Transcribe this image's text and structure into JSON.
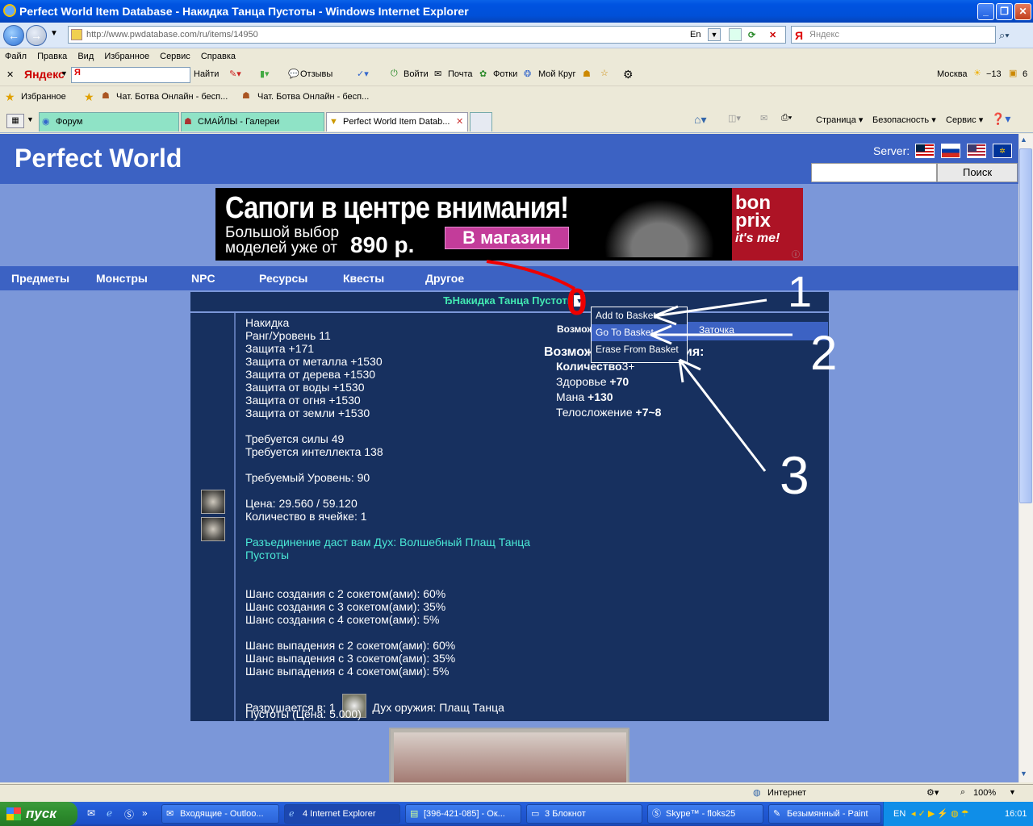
{
  "window": {
    "title": "Perfect World Item Database - Накидка Танца Пустоты - Windows Internet Explorer"
  },
  "address": {
    "url": "http://www.pwdatabase.com/ru/items/14950",
    "lang": "En",
    "search_placeholder": "Яндекс"
  },
  "menu": [
    "Файл",
    "Правка",
    "Вид",
    "Избранное",
    "Сервис",
    "Справка"
  ],
  "yandex_bar": {
    "brand": "Яндекс",
    "find": "Найти",
    "otzyvy": "Отзывы",
    "voiti": "Войти",
    "pochta": "Почта",
    "fotki": "Фотки",
    "moi_krug": "Мой Круг",
    "city": "Москва",
    "temp": "−13",
    "num": "6"
  },
  "favorites": {
    "label": "Избранное",
    "items": [
      "Чат. Ботва Онлайн - бесп...",
      "Чат. Ботва Онлайн - бесп..."
    ]
  },
  "tabs": [
    "Форум",
    "СМАЙЛЫ - Галереи",
    "Perfect World Item Datab..."
  ],
  "cmdbar": {
    "page": "Страница",
    "security": "Безопасность",
    "service": "Сервис"
  },
  "site": {
    "title": "Perfect World",
    "server_label": "Server:",
    "search_button": "Поиск",
    "banner": {
      "headline": "Сапоги в центре внимания!",
      "sub1": "Большой выбор",
      "sub2": "моделей уже от",
      "price": "890 р.",
      "button": "В магазин",
      "logo1": "bon",
      "logo2": "prix",
      "logo3": "it's me!"
    },
    "nav": [
      "Предметы",
      "Монстры",
      "NPC",
      "Ресурсы",
      "Квесты",
      "Другое"
    ],
    "item_title": "ЂНакидка Танца Пустоты",
    "props": [
      {
        "t": "Накидка",
        "c": ""
      },
      {
        "t": "Ранг/Уровень 11",
        "c": ""
      },
      {
        "t": "Защита +171",
        "c": ""
      },
      {
        "t": "Защита от металла +1530",
        "c": ""
      },
      {
        "t": "Защита от дерева +1530",
        "c": ""
      },
      {
        "t": "Защита от воды +1530",
        "c": ""
      },
      {
        "t": "Защита от огня +1530",
        "c": ""
      },
      {
        "t": "Защита от земли +1530",
        "c": ""
      },
      {
        "t": "",
        "c": ""
      },
      {
        "t": "Требуется силы 49",
        "c": ""
      },
      {
        "t": "Требуется интеллекта 138",
        "c": ""
      },
      {
        "t": "",
        "c": ""
      },
      {
        "t": "Требуемый Уровень: 90",
        "c": ""
      },
      {
        "t": "",
        "c": ""
      },
      {
        "t": "Цена: 29.560 / 59.120",
        "c": ""
      },
      {
        "t": "Количество в ячейке: 1",
        "c": ""
      },
      {
        "t": "",
        "c": ""
      },
      {
        "t": "Разъединение даст вам Дух: Волшебный Плащ Танца",
        "c": "cyan"
      },
      {
        "t": "Пустоты",
        "c": "cyan"
      },
      {
        "t": "",
        "c": ""
      },
      {
        "t": "",
        "c": ""
      },
      {
        "t": "Шанс создания с 2 сокетом(ами): 60%",
        "c": ""
      },
      {
        "t": "Шанс создания с 3 сокетом(ами): 35%",
        "c": ""
      },
      {
        "t": "Шанс создания с 4 сокетом(ами): 5%",
        "c": ""
      },
      {
        "t": "",
        "c": ""
      },
      {
        "t": "Шанс выпадения с 2 сокетом(ами): 60%",
        "c": ""
      },
      {
        "t": "Шанс выпадения с 3 сокетом(ами): 35%",
        "c": ""
      },
      {
        "t": "Шанс выпадения с 4 сокетом(ами): 5%",
        "c": ""
      },
      {
        "t": "",
        "c": ""
      }
    ],
    "breaks_in": "Разрушается в: 1",
    "spirit": "Дух оружия: Плащ Танца",
    "spirit2": "Пустоты (Цена: 5.000)",
    "right": {
      "tab_label": "Возмож",
      "heading_a": "Возмож",
      "heading_b": "ия:",
      "qty_label": "Количество",
      "qty_val": "3+",
      "stats": [
        {
          "k": "Здоровье",
          "v": "+70"
        },
        {
          "k": "Мана",
          "v": "+130"
        },
        {
          "k": "Телосложение",
          "v": "+7~8"
        }
      ]
    },
    "context_menu": [
      "Add to Basket",
      "Go To Basket",
      "Erase From Basket"
    ],
    "zatochka": "Заточка"
  },
  "annotations": [
    "0",
    "1",
    "2",
    "3"
  ],
  "status": {
    "zone": "Интернет",
    "zoom": "100%"
  },
  "taskbar": {
    "start": "пуск",
    "tasks": [
      "Входящие - Outloo...",
      "4 Internet Explorer",
      "[396-421-085] - Ок...",
      "3 Блокнот",
      "Skype™ - floks25",
      "Безымянный - Paint"
    ],
    "lang": "EN",
    "time": "16:01"
  }
}
